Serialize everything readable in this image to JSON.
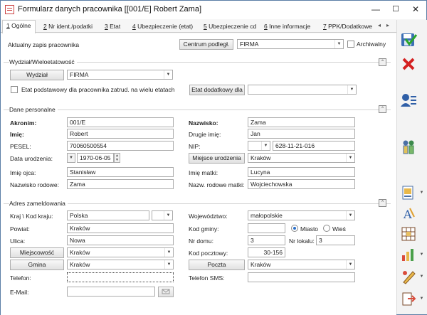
{
  "window": {
    "title": "Formularz danych pracownika [[001/E] Robert Zama]",
    "minimize": "—",
    "maximize": "☐",
    "close": "✕"
  },
  "tabs": [
    {
      "key": "1",
      "label": "Ogólne"
    },
    {
      "key": "2",
      "label": "Nr ident./podatki"
    },
    {
      "key": "3",
      "label": "Etat"
    },
    {
      "key": "4",
      "label": "Ubezpieczenie (etat)"
    },
    {
      "key": "5",
      "label": "Ubezpieczenie cd"
    },
    {
      "key": "6",
      "label": "Inne informacje"
    },
    {
      "key": "7",
      "label": "PPK/Dodatkowe"
    }
  ],
  "tab_nav": {
    "prev": "◂",
    "next": "▸"
  },
  "top": {
    "label": "Aktualny zapis pracownika",
    "centrum_button": "Centrum podległ.",
    "centrum_value": "FIRMA",
    "archiwalny_label": "Archiwalny"
  },
  "wydzial": {
    "title": "Wydział/Wieloetatowość",
    "button": "Wydział",
    "value": "FIRMA",
    "etat_checkbox_label": "Etat podstawowy dla pracownika zatrud. na wielu etatach",
    "etat_dodatkowy_button": "Etat dodatkowy dla",
    "etat_dodatkowy_value": ""
  },
  "dane": {
    "title": "Dane personalne",
    "akronim_label": "Akronim:",
    "akronim": "001/E",
    "nazwisko_label": "Nazwisko:",
    "nazwisko": "Zama",
    "imie_label": "Imię:",
    "imie": "Robert",
    "drugie_imie_label": "Drugie imię:",
    "drugie_imie": "Jan",
    "pesel_label": "PESEL:",
    "pesel": "70060500554",
    "nip_label": "NIP:",
    "nip": "628-11-21-016",
    "data_ur_label": "Data urodzenia:",
    "data_ur": "1970-06-05",
    "miejsce_button": "Miejsce urodzenia",
    "miejsce": "Kraków",
    "imie_ojca_label": "Imię ojca:",
    "imie_ojca": "Stanisław",
    "imie_matki_label": "Imię matki:",
    "imie_matki": "Lucyna",
    "nazw_rod_label": "Nazwisko rodowe:",
    "nazw_rod": "Zama",
    "nazw_rod_matki_label": "Nazw. rodowe matki:",
    "nazw_rod_matki": "Wojciechowska"
  },
  "adres": {
    "title": "Adres zameldowania",
    "kraj_label": "Kraj \\ Kod kraju:",
    "kraj": "Polska",
    "wojewodztwo_label": "Województwo:",
    "wojewodztwo": "małopolskie",
    "powiat_label": "Powiat:",
    "powiat": "Kraków",
    "kod_gminy_label": "Kod gminy:",
    "kod_gminy": "",
    "miasto_label": "Miasto",
    "wies_label": "Wieś",
    "ulica_label": "Ulica:",
    "ulica": "Nowa",
    "nr_domu_label": "Nr domu:",
    "nr_domu": "3",
    "nr_lokalu_label": "Nr lokalu:",
    "nr_lokalu": "3",
    "miejscowosc_button": "Miejscowość",
    "miejscowosc": "Kraków",
    "kod_pocztowy_label": "Kod pocztowy:",
    "kod_pocztowy": "30-156",
    "gmina_button": "Gmina",
    "gmina": "Kraków",
    "poczta_button": "Poczta",
    "poczta": "Kraków",
    "telefon_label": "Telefon:",
    "telefon": "",
    "telefon_sms_label": "Telefon SMS:",
    "telefon_sms": "",
    "email_label": "E-Mail:",
    "email": ""
  },
  "toolbar": [
    "save-icon",
    "cancel-icon",
    "employee-card-icon",
    "people-icon",
    "document-icon",
    "text-tool-icon",
    "grid-icon",
    "chart-icon",
    "pencil-icon",
    "export-icon"
  ],
  "colors": {
    "accent": "#2a6fc9",
    "cancel": "#d42020",
    "border": "#ababab"
  }
}
